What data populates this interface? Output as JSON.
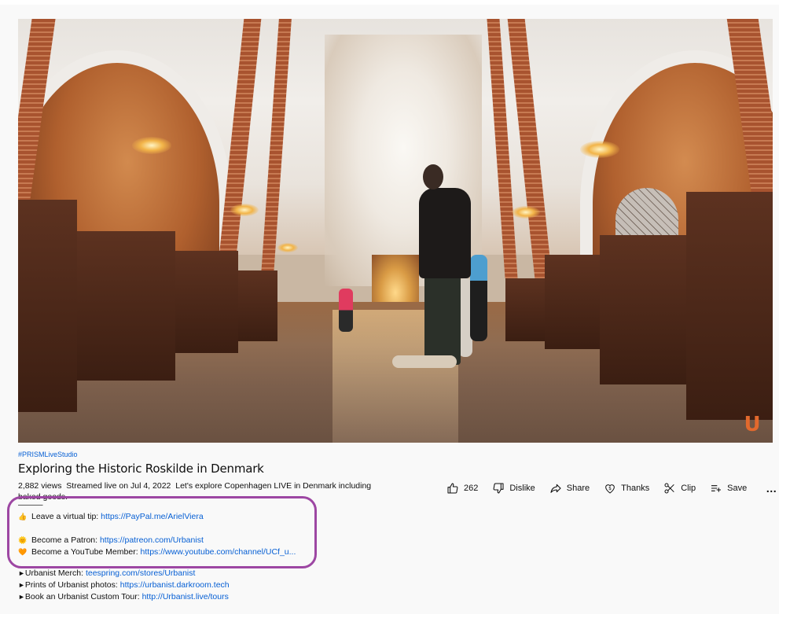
{
  "video": {
    "channel_watermark": "U",
    "accent_color": "#e2692d"
  },
  "meta": {
    "hashtag": "#PRISMLiveStudio",
    "title": "Exploring the Historic Roskilde in Denmark"
  },
  "actions": {
    "like_count": "262",
    "dislike": "Dislike",
    "share": "Share",
    "thanks": "Thanks",
    "clip": "Clip",
    "save": "Save",
    "more": "…"
  },
  "description": {
    "views": "2,882 views",
    "date": "Streamed live on Jul 4, 2022",
    "intro": "Let's explore Copenhagen LIVE in Denmark including",
    "intro_cont": "baked goods.",
    "divider": "———",
    "tip": {
      "emoji": "👍",
      "label": "Leave a virtual tip: ",
      "link": "https://PayPal.me/ArielViera"
    },
    "patron": {
      "emoji": "🌞",
      "label": "Become a Patron: ",
      "link": "https://patreon.com/Urbanist"
    },
    "member": {
      "emoji": "🧡",
      "label": "Become a YouTube Member: ",
      "link": "https://www.youtube.com/channel/UCf_u..."
    },
    "merch": {
      "arrow": "►",
      "label": "Urbanist Merch: ",
      "link": "teespring.com/stores/Urbanist"
    },
    "prints": {
      "arrow": "►",
      "label": "Prints of Urbanist photos: ",
      "link": "https://urbanist.darkroom.tech"
    },
    "tour": {
      "arrow": "►",
      "label": "Book an Urbanist Custom Tour: ",
      "link": "http://Urbanist.live/tours"
    }
  },
  "annotation": {
    "highlight_color": "#9d47a3"
  }
}
